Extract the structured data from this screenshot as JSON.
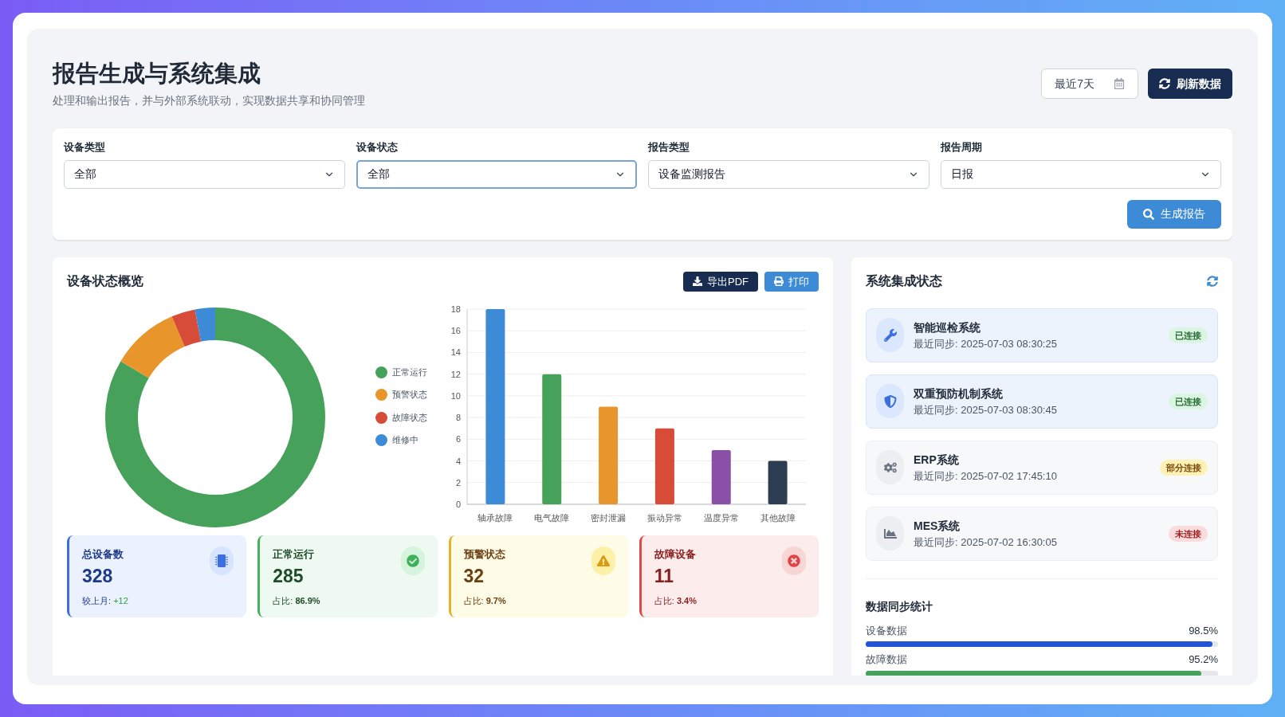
{
  "header": {
    "title": "报告生成与系统集成",
    "subtitle": "处理和输出报告，并与外部系统联动，实现数据共享和协同管理",
    "date_range": "最近7天",
    "refresh_button": "刷新数据"
  },
  "filters": [
    {
      "label": "设备类型",
      "value": "全部",
      "focused": false
    },
    {
      "label": "设备状态",
      "value": "全部",
      "focused": true
    },
    {
      "label": "报告类型",
      "value": "设备监测报告",
      "focused": false
    },
    {
      "label": "报告周期",
      "value": "日报",
      "focused": false
    }
  ],
  "generate_button": "生成报告",
  "overview": {
    "title": "设备状态概览",
    "export_button": "导出PDF",
    "print_button": "打印",
    "legend": [
      {
        "label": "正常运行",
        "color": "#46a15a"
      },
      {
        "label": "预警状态",
        "color": "#e8952b"
      },
      {
        "label": "故障状态",
        "color": "#d64c38"
      },
      {
        "label": "维修中",
        "color": "#3d8bd6"
      }
    ],
    "chart_data": {
      "type": "bar",
      "grid": true,
      "categories": [
        "轴承故障",
        "电气故障",
        "密封泄漏",
        "振动异常",
        "温度异常",
        "其他故障"
      ],
      "series": [
        {
          "colors": [
            "#3d8bd6",
            "#46a15a",
            "#e8952b",
            "#d64c38",
            "#8a50a8",
            "#2e3e52"
          ],
          "values": [
            18,
            12,
            9,
            7,
            5,
            4
          ]
        }
      ],
      "ylim": [
        0,
        18
      ],
      "yticks": [
        0,
        2,
        4,
        6,
        8,
        10,
        12,
        14,
        16,
        18
      ]
    },
    "stats": [
      {
        "kind": "total",
        "label": "总设备数",
        "value": "328",
        "footer_label": "较上月:",
        "footer_value": "+12"
      },
      {
        "kind": "normal",
        "label": "正常运行",
        "value": "285",
        "footer_label": "占比:",
        "footer_value": "86.9%"
      },
      {
        "kind": "warning",
        "label": "预警状态",
        "value": "32",
        "footer_label": "占比:",
        "footer_value": "9.7%"
      },
      {
        "kind": "fault",
        "label": "故障设备",
        "value": "11",
        "footer_label": "占比:",
        "footer_value": "3.4%"
      }
    ]
  },
  "integration": {
    "title": "系统集成状态",
    "systems": [
      {
        "name": "智能巡检系统",
        "sync": "最近同步: 2025-07-03 08:30:25",
        "status": "已连接",
        "kind": "connected"
      },
      {
        "name": "双重预防机制系统",
        "sync": "最近同步: 2025-07-03 08:30:45",
        "status": "已连接",
        "kind": "connected"
      },
      {
        "name": "ERP系统",
        "sync": "最近同步: 2025-07-02 17:45:10",
        "status": "部分连接",
        "kind": "partial"
      },
      {
        "name": "MES系统",
        "sync": "最近同步: 2025-07-02 16:30:05",
        "status": "未连接",
        "kind": "disconnected"
      }
    ],
    "sync_title": "数据同步统计",
    "sync_stats": [
      {
        "label": "设备数据",
        "reading": "98.5%",
        "level": 0.985,
        "color": "#2453d6"
      },
      {
        "label": "故障数据",
        "reading": "95.2%",
        "level": 0.952,
        "color": "#46a15a"
      }
    ]
  }
}
